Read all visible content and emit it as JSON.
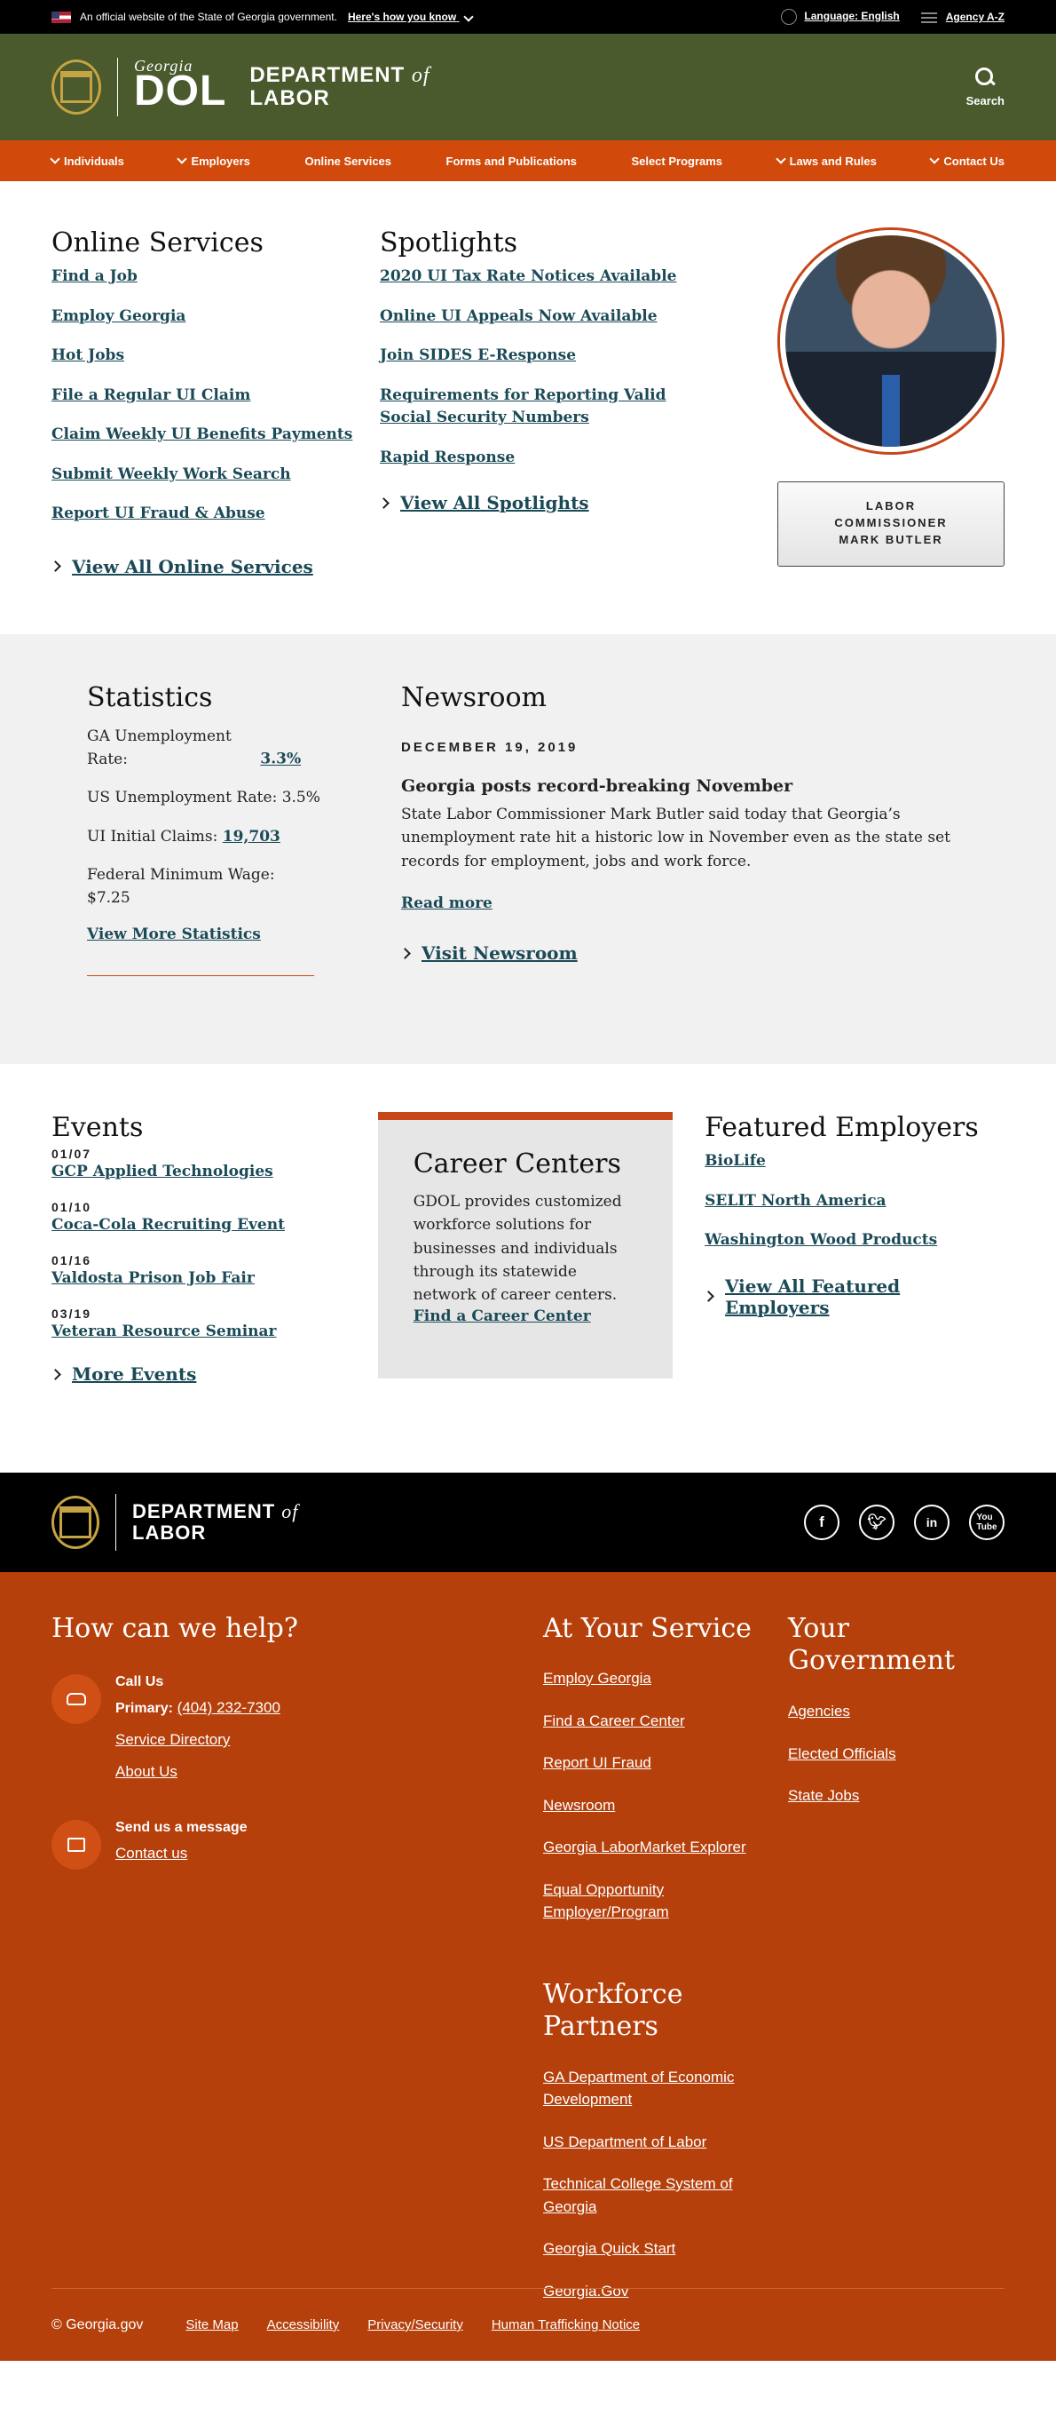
{
  "gov_banner": {
    "text": "An official website of the State of Georgia government.",
    "know_link": "Here's how you know",
    "language": "Language: English",
    "agency": "Agency A-Z"
  },
  "header": {
    "ga_script": "Georgia",
    "dol": "DOL",
    "dept_line1": "DEPARTMENT",
    "dept_of": "of",
    "dept_line2": "LABOR",
    "search_label": "Search"
  },
  "nav": [
    {
      "label": "Individuals"
    },
    {
      "label": "Employers"
    },
    {
      "label": "Online Services"
    },
    {
      "label": "Forms and Publications"
    },
    {
      "label": "Select Programs"
    },
    {
      "label": "Laws and Rules"
    },
    {
      "label": "Contact Us"
    }
  ],
  "online_services": {
    "title": "Online Services",
    "links": [
      "Find a Job",
      "Employ Georgia",
      "Hot Jobs",
      "File a Regular UI Claim",
      "Claim Weekly UI Benefits Payments",
      "Submit Weekly Work Search",
      "Report UI Fraud & Abuse"
    ],
    "more": "View All Online Services"
  },
  "spotlights": {
    "title": "Spotlights",
    "links": [
      "2020 UI Tax Rate Notices Available",
      "Online UI Appeals Now Available",
      "Join SIDES E-Response",
      "Requirements for Reporting Valid Social Security Numbers",
      "Rapid Response"
    ],
    "more": "View All Spotlights"
  },
  "commissioner": {
    "line1": "LABOR",
    "line2": "COMMISSIONER",
    "line3": "MARK BUTLER"
  },
  "statistics": {
    "title": "Statistics",
    "ga_label": "GA Unemployment Rate:",
    "ga_value": "3.3%",
    "us_text": "US Unemployment Rate: 3.5%",
    "claims_label": "UI Initial Claims:",
    "claims_value": "19,703",
    "wage_text": "Federal Minimum Wage: $7.25",
    "more": "View More Statistics"
  },
  "newsroom": {
    "title": "Newsroom",
    "date": "DECEMBER 19, 2019",
    "headline": "Georgia posts record-breaking November",
    "body": "State Labor Commissioner Mark Butler said today that Georgia’s unemployment rate hit a historic low in November even as the state set records for employment, jobs and work force.",
    "read_more": "Read more",
    "more": "Visit Newsroom"
  },
  "events": {
    "title": "Events",
    "items": [
      {
        "date": "01/07",
        "name": "GCP Applied Technologies"
      },
      {
        "date": "01/10",
        "name": "Coca-Cola Recruiting Event"
      },
      {
        "date": "01/16",
        "name": "Valdosta Prison Job Fair"
      },
      {
        "date": "03/19",
        "name": "Veteran Resource Seminar"
      }
    ],
    "more": "More Events"
  },
  "career_centers": {
    "title": "Career Centers",
    "body": "GDOL provides customized workforce solutions for businesses and individuals through its statewide network of career centers.",
    "link": "Find a Career Center"
  },
  "featured": {
    "title": "Featured Employers",
    "links": [
      "BioLife",
      "SELIT North America",
      "Washington Wood Products"
    ],
    "more": "View All Featured Employers"
  },
  "footer": {
    "dept_line1": "DEPARTMENT",
    "dept_of": "of",
    "dept_line2": "LABOR",
    "socials": [
      "f",
      "t",
      "in",
      "yt"
    ],
    "help_title": "How can we help?",
    "call_title": "Call Us",
    "primary_label": "Primary:",
    "primary_phone": "(404) 232-7300",
    "service_directory": "Service Directory",
    "about": "About Us",
    "msg_title": "Send us a message",
    "contact": "Contact us",
    "service_title": "At Your Service",
    "service_links": [
      "Employ Georgia",
      "Find a Career Center",
      "Report UI Fraud",
      "Newsroom",
      "Georgia LaborMarket Explorer",
      "Equal Opportunity Employer/Program"
    ],
    "wp_title": "Workforce Partners",
    "wp_links": [
      "GA Department of Economic Development",
      "US Department of Labor",
      "Technical College System of Georgia",
      "Georgia Quick Start",
      "Georgia.Gov"
    ],
    "gov_title": "Your Government",
    "gov_links": [
      "Agencies",
      "Elected Officials",
      "State Jobs"
    ],
    "copyright": "© Georgia.gov",
    "legal_links": [
      "Site Map",
      "Accessibility",
      "Privacy/Security",
      "Human Trafficking Notice"
    ]
  }
}
